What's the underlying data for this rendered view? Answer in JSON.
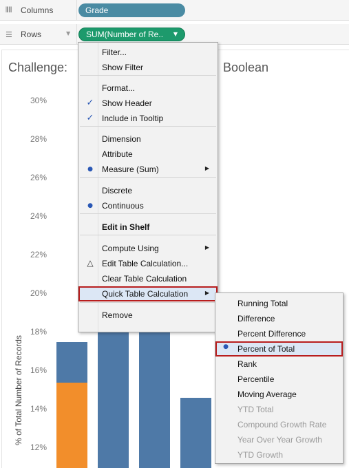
{
  "shelves": {
    "columns": {
      "label": "Columns",
      "icon": "columns-icon",
      "pill": "Grade"
    },
    "rows": {
      "label": "Rows",
      "icon": "rows-icon",
      "pill": "SUM(Number of Re.."
    }
  },
  "view": {
    "title_left": "Challenge:",
    "title_right": "Boolean",
    "y_axis_label": "% of Total Number of Records",
    "y_ticks": [
      "30%",
      "28%",
      "26%",
      "24%",
      "22%",
      "20%",
      "18%",
      "16%",
      "14%",
      "12%"
    ]
  },
  "chart_data": {
    "type": "bar",
    "ylabel": "% of Total Number of Records",
    "ylim": [
      11.3,
      30.6
    ],
    "y_ticks": [
      "30%",
      "28%",
      "26%",
      "24%",
      "22%",
      "20%",
      "18%",
      "16%",
      "14%",
      "12%"
    ],
    "colors": {
      "blue": "#4e79a7",
      "orange": "#f28e2b"
    },
    "bars": [
      {
        "index": 1,
        "segments": [
          {
            "color": "orange",
            "from": 11.3,
            "to": 15.4
          },
          {
            "color": "blue",
            "from": 15.4,
            "to": 17.5
          }
        ]
      },
      {
        "index": 2,
        "segments": [
          {
            "color": "blue",
            "from": 11.3,
            "to": 18.2
          }
        ]
      },
      {
        "index": 3,
        "segments": [
          {
            "color": "blue",
            "from": 11.3,
            "to": 18.2
          }
        ]
      },
      {
        "index": 4,
        "segments": [
          {
            "color": "blue",
            "from": 11.3,
            "to": 14.6
          }
        ]
      }
    ]
  },
  "context_menu": {
    "items": [
      {
        "label": "Filter..."
      },
      {
        "label": "Show Filter"
      },
      {
        "label": "Format..."
      },
      {
        "label": "Show Header",
        "mark": "check"
      },
      {
        "label": "Include in Tooltip",
        "mark": "check"
      },
      {
        "label": "Dimension"
      },
      {
        "label": "Attribute"
      },
      {
        "label": "Measure (Sum)",
        "mark": "radio",
        "submenu": true
      },
      {
        "label": "Discrete"
      },
      {
        "label": "Continuous",
        "mark": "radio"
      },
      {
        "label": "Edit in Shelf",
        "bold": true
      },
      {
        "label": "Compute Using",
        "submenu": true
      },
      {
        "label": "Edit Table Calculation...",
        "mark": "delta"
      },
      {
        "label": "Clear Table Calculation"
      },
      {
        "label": "Quick Table Calculation",
        "submenu": true,
        "highlighted": true
      },
      {
        "label": "Remove"
      }
    ]
  },
  "quick_table_calc_menu": {
    "items": [
      {
        "label": "Running Total",
        "enabled": true
      },
      {
        "label": "Difference",
        "enabled": true
      },
      {
        "label": "Percent Difference",
        "enabled": true
      },
      {
        "label": "Percent of Total",
        "enabled": true,
        "selected": true,
        "highlighted": true
      },
      {
        "label": "Rank",
        "enabled": true
      },
      {
        "label": "Percentile",
        "enabled": true
      },
      {
        "label": "Moving Average",
        "enabled": true
      },
      {
        "label": "YTD Total",
        "enabled": false
      },
      {
        "label": "Compound Growth Rate",
        "enabled": false
      },
      {
        "label": "Year Over Year Growth",
        "enabled": false
      },
      {
        "label": "YTD Growth",
        "enabled": false
      }
    ]
  },
  "glyphs": {
    "check": "✓",
    "radio": "●",
    "delta": "△",
    "submenu_arrow": "▶",
    "caret": "▼"
  }
}
